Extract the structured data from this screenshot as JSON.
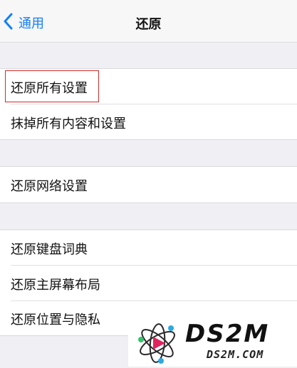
{
  "navbar": {
    "back_label": "通用",
    "title": "还原"
  },
  "groups": [
    {
      "items": [
        "还原所有设置",
        "抹掉所有内容和设置"
      ]
    },
    {
      "items": [
        "还原网络设置"
      ]
    },
    {
      "items": [
        "还原键盘词典",
        "还原主屏幕布局",
        "还原位置与隐私"
      ]
    }
  ],
  "watermark": {
    "brand": "DS2M",
    "domain": "DS2M.COM"
  },
  "colors": {
    "background": "#efeff4",
    "accent": "#147efb",
    "highlight": "#d22b2b"
  },
  "icons": {
    "back": "chevron-left-icon"
  }
}
